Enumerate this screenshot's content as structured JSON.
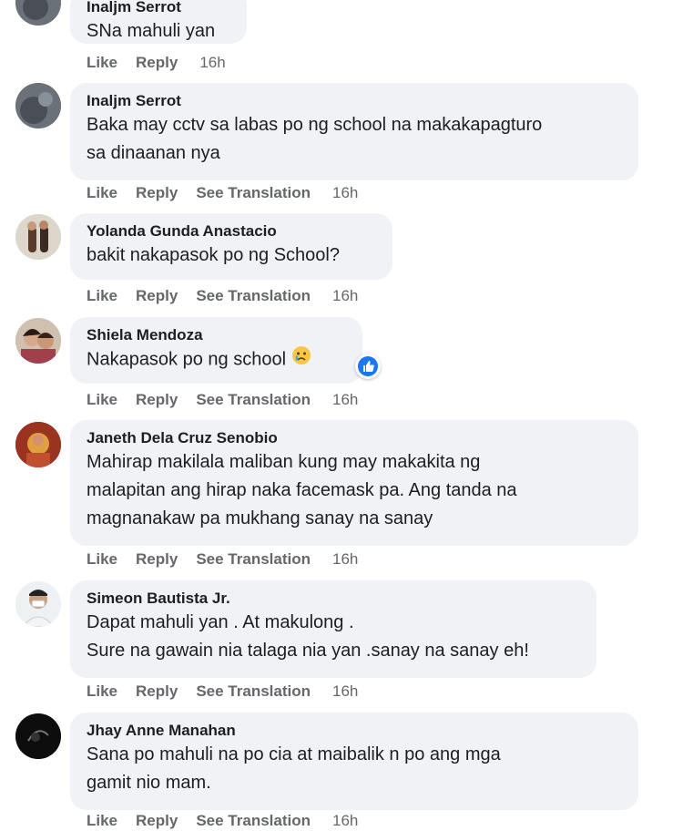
{
  "comments": [
    {
      "author": "Inaljm Serrot",
      "lines": [
        "SNa mahuli yan"
      ],
      "like": "Like",
      "reply": "Reply",
      "translate": "",
      "time": "16h"
    },
    {
      "author": "Inaljm Serrot",
      "lines": [
        "Baka may cctv sa labas po ng school na makakapagturo",
        "sa dinaanan nya"
      ],
      "like": "Like",
      "reply": "Reply",
      "translate": "See Translation",
      "time": "16h"
    },
    {
      "author": "Yolanda Gunda Anastacio",
      "lines": [
        "bakit nakapasok po ng School?"
      ],
      "like": "Like",
      "reply": "Reply",
      "translate": "See Translation",
      "time": "16h"
    },
    {
      "author": "Shiela Mendoza",
      "lines": [
        "Nakapasok po ng school"
      ],
      "emoji": "crying-face-icon",
      "reaction": "like-reaction-icon",
      "like": "Like",
      "reply": "Reply",
      "translate": "See Translation",
      "time": "16h"
    },
    {
      "author": "Janeth Dela Cruz Senobio",
      "lines": [
        "Mahirap makilala maliban kung may makakita ng",
        "malapitan ang hirap naka facemask pa. Ang tanda na",
        "magnanakaw pa mukhang sanay na sanay"
      ],
      "like": "Like",
      "reply": "Reply",
      "translate": "See Translation",
      "time": "16h"
    },
    {
      "author": "Simeon Bautista Jr.",
      "lines": [
        "Dapat mahuli yan . At makulong .",
        "Sure na gawain nia talaga nia yan .sanay na sanay eh!"
      ],
      "like": "Like",
      "reply": "Reply",
      "translate": "See Translation",
      "time": "16h"
    },
    {
      "author": "Jhay Anne Manahan",
      "lines": [
        "Sana po mahuli na po cia at maibalik n po ang mga",
        "gamit nio mam."
      ],
      "like": "Like",
      "reply": "Reply",
      "translate": "See Translation",
      "time": "16h"
    }
  ]
}
